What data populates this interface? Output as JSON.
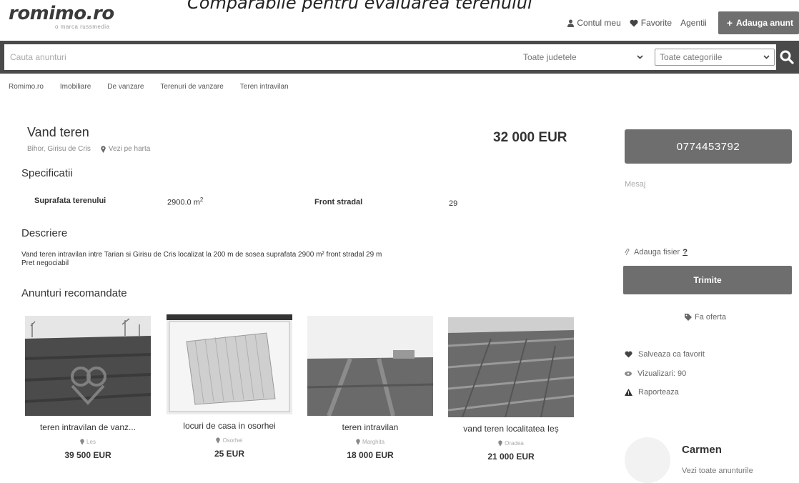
{
  "overlay_caption": "Comparabile pentru evaluarea terenului",
  "brand": {
    "name": "romimo.ro",
    "subtitle": "o marca russmedia"
  },
  "topnav": {
    "account": "Contul meu",
    "favorites": "Favorite",
    "agents": "Agentii",
    "add_listing": "Adauga anunt"
  },
  "search": {
    "placeholder": "Cauta anunturi",
    "county": "Toate judetele",
    "category": "Toate categoriile"
  },
  "breadcrumb": [
    "Romimo.ro",
    "Imobiliare",
    "De vanzare",
    "Terenuri de vanzare",
    "Teren intravilan"
  ],
  "listing": {
    "title": "Vand teren",
    "location": "Bihor, Girisu de Cris",
    "map_link": "Vezi pe harta",
    "price": "32 000 EUR",
    "specs_title": "Specificatii",
    "specs": {
      "area_label": "Suprafata terenului",
      "area_value": "2900.0 m",
      "area_unit_exp": "2",
      "front_label": "Front stradal",
      "front_value": "29"
    },
    "description_title": "Descriere",
    "description_line1": "Vand teren intravilan intre Tarian si Girisu de Cris localizat la 200 m de sosea  suprafata 2900 m²  front stradal 29 m",
    "description_line2": "Pret negociabil"
  },
  "recommended": {
    "title": "Anunturi recomandate",
    "items": [
      {
        "title": "teren intravilan de vanz...",
        "location": "Les",
        "price": "39 500 EUR"
      },
      {
        "title": "locuri de casa in osorhei",
        "location": "Osorhei",
        "price": "25 EUR"
      },
      {
        "title": "teren intravilan",
        "location": "Marghita",
        "price": "18 000 EUR"
      },
      {
        "title": "vand teren localitatea Ieș",
        "location": "Oradea",
        "price": "21 000 EUR"
      }
    ]
  },
  "sidebar": {
    "phone": "0774453792",
    "message_placeholder": "Mesaj",
    "attach": "Adauga fisier",
    "attach_help": "?",
    "send": "Trimite",
    "offer": "Fa oferta",
    "save_favorite": "Salveaza ca favorit",
    "views": "Vizualizari: 90",
    "report": "Raporteaza",
    "seller_name": "Carmen",
    "seller_all": "Vezi toate anunturile"
  },
  "colors": {
    "button_gray": "#6e6e6e",
    "search_bar": "#4a4a4a"
  }
}
